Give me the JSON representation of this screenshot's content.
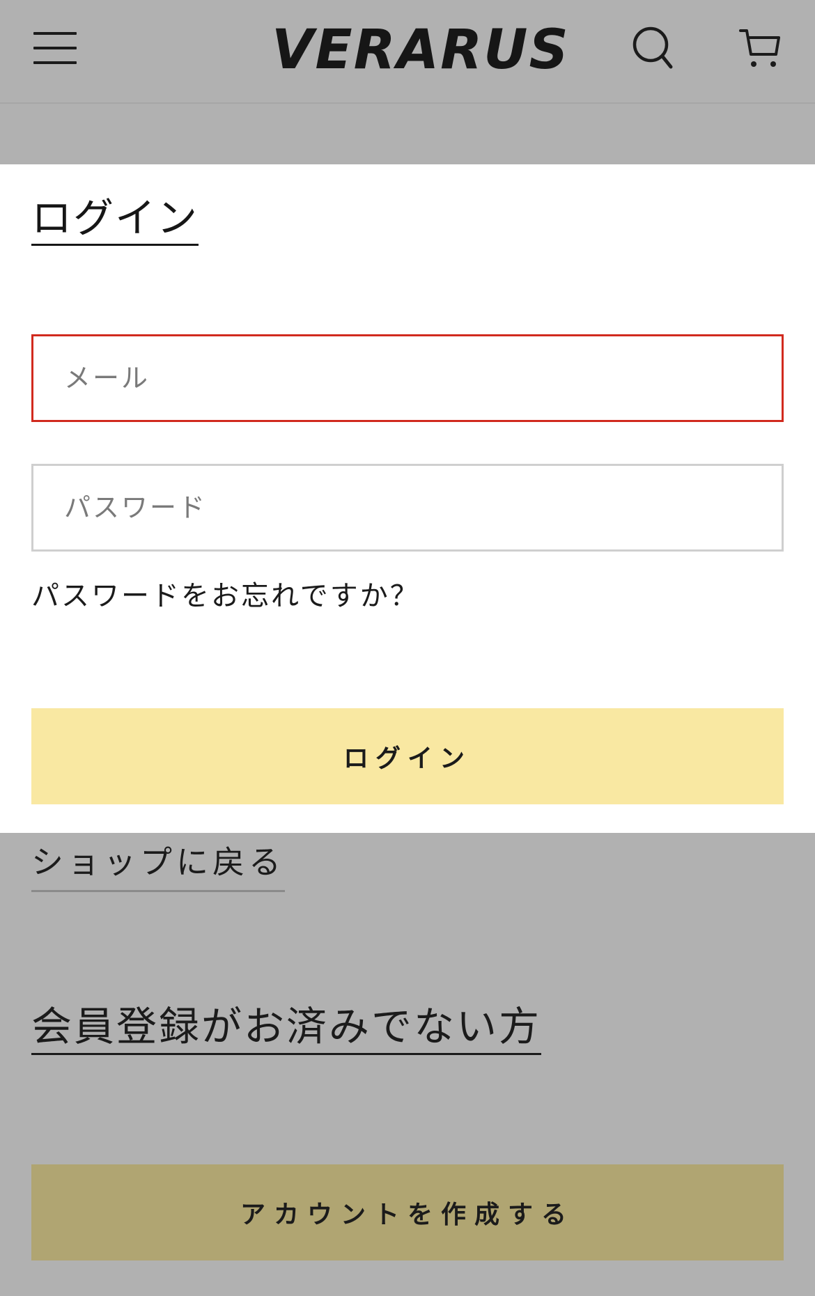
{
  "header": {
    "logo": "VERARUS",
    "menu_icon": "hamburger-menu-icon",
    "search_icon": "search-icon",
    "cart_icon": "cart-icon"
  },
  "login": {
    "title": "ログイン",
    "email_placeholder": "メール",
    "password_placeholder": "パスワード",
    "forgot_password": "パスワードをお忘れですか？",
    "submit_label": "ログイン"
  },
  "footer_links": {
    "back_to_shop": "ショップに戻る"
  },
  "register": {
    "heading": "会員登録がお済みでない方",
    "create_account_label": "アカウントを作成する"
  },
  "colors": {
    "overlay_bg": "#b1b1b1",
    "card_bg": "#ffffff",
    "login_button": "#f9e8a2",
    "create_button": "#b0a572",
    "error_border": "#d12a1e"
  }
}
